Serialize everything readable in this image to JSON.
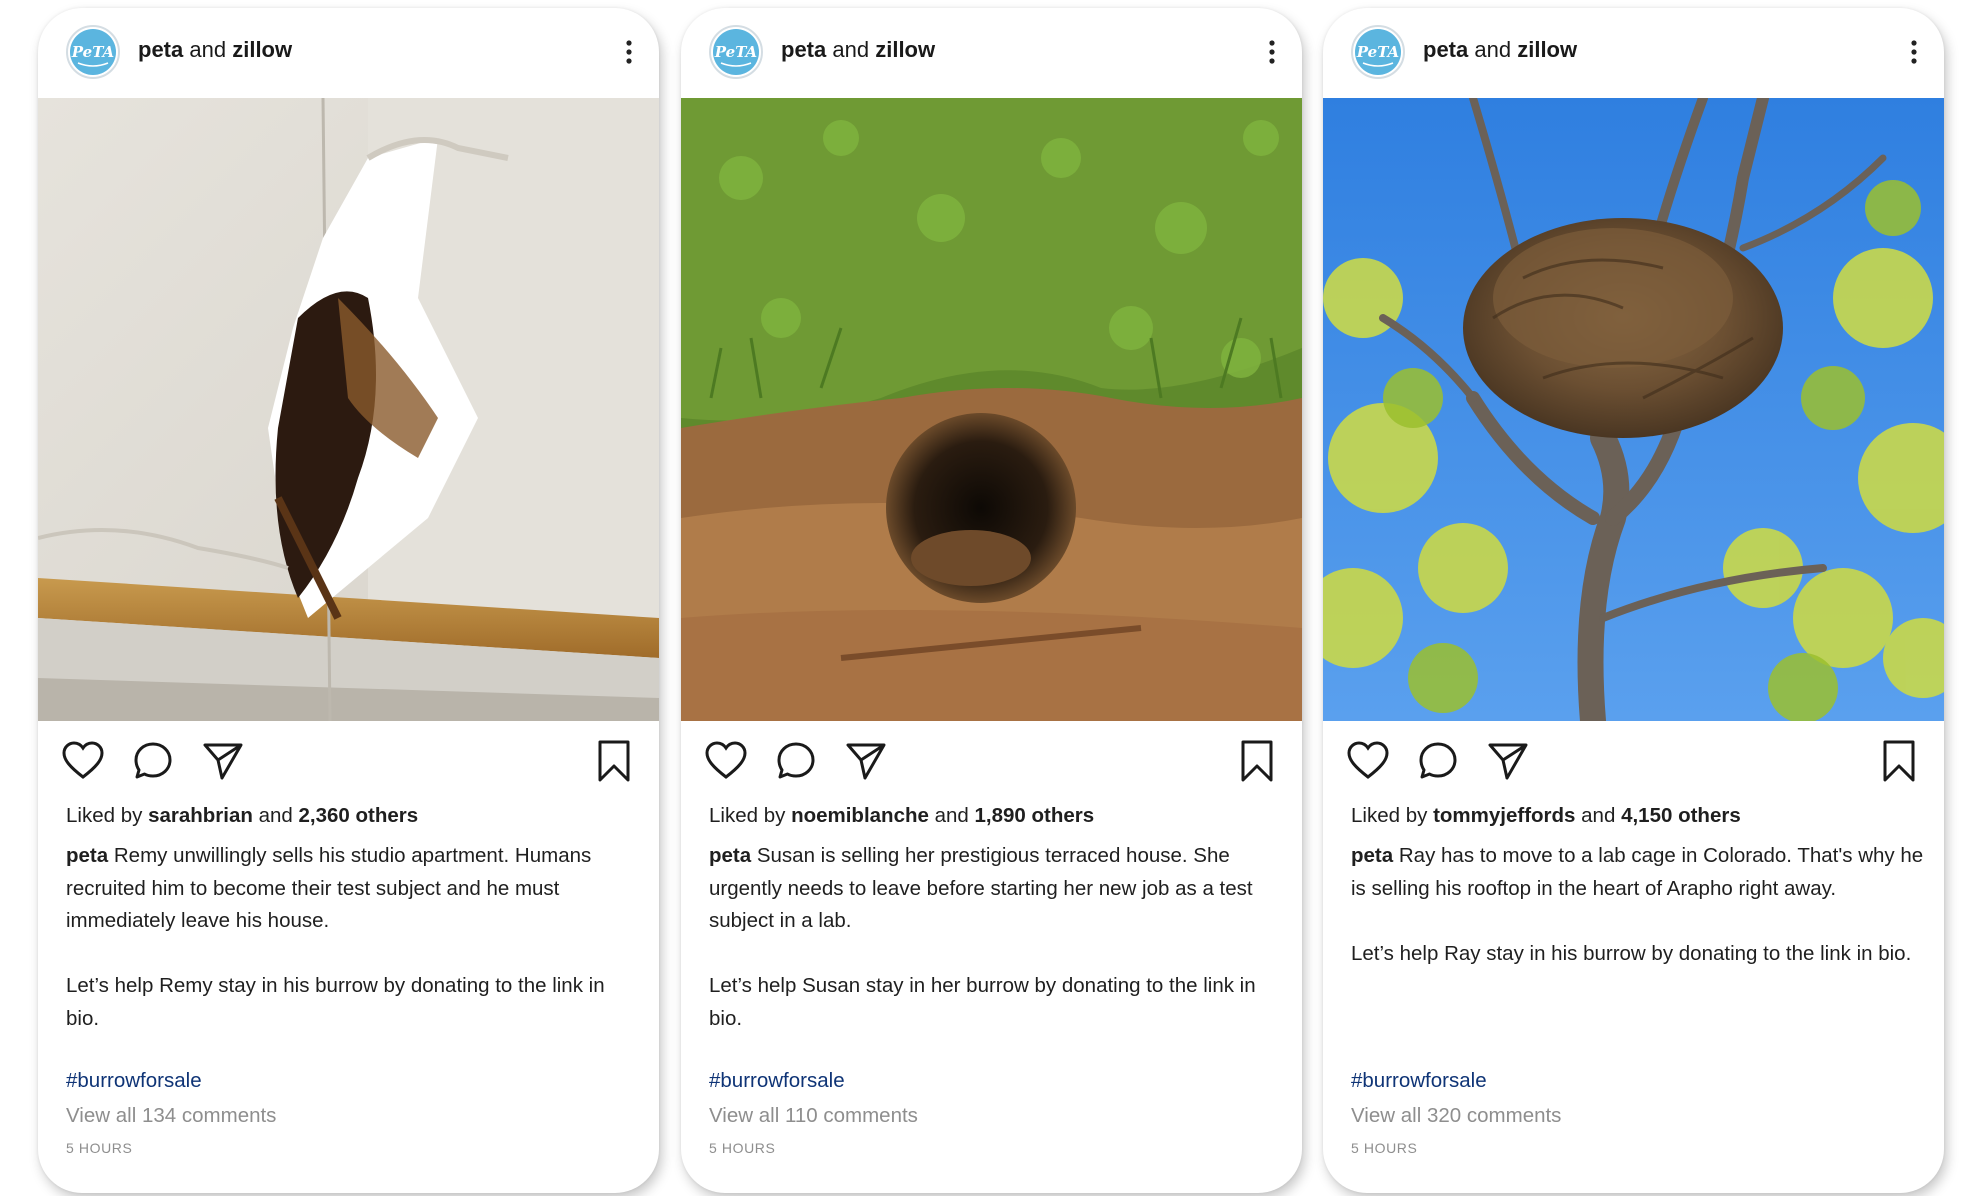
{
  "colors": {
    "accent_link": "#0f3476",
    "muted_text": "#8e8e8e",
    "peta_logo_blue": "#5bb5df"
  },
  "icons": {
    "avatar": "peta-logo-icon",
    "more": "more-vertical-icon",
    "like": "heart-icon",
    "comment": "comment-bubble-icon",
    "share": "paper-plane-icon",
    "save": "bookmark-icon"
  },
  "posts": [
    {
      "avatar_text": "PeTA",
      "account": {
        "primary": "peta",
        "joiner": "and",
        "secondary": "zillow"
      },
      "image": {
        "subject": "damaged drywall corner with gnawed mouse hole"
      },
      "likes": {
        "prefix": "Liked by",
        "user": "sarahbrian",
        "joiner": "and",
        "others": "2,360 others"
      },
      "caption": {
        "author": "peta",
        "text1": "Remy unwillingly sells his studio apartment. Humans recruited him to become their test subject and he must immediately leave his house.",
        "text2": "Let’s help Remy stay in his burrow by donating to the link in bio."
      },
      "hashtag": "#burrowforsale",
      "comments": {
        "prefix": "View all",
        "count_text": "134 comments"
      },
      "timestamp": "5 HOURS"
    },
    {
      "avatar_text": "PeTA",
      "account": {
        "primary": "peta",
        "joiner": "and",
        "secondary": "zillow"
      },
      "image": {
        "subject": "burrow hole in grassy dirt bank"
      },
      "likes": {
        "prefix": "Liked by",
        "user": "noemiblanche",
        "joiner": "and",
        "others": "1,890 others"
      },
      "caption": {
        "author": "peta",
        "text1": "Susan is selling her prestigious terraced house. She urgently needs to leave before starting her new job as a test subject in a lab.",
        "text2": "Let’s help Susan stay in her burrow by donating to the link in bio."
      },
      "hashtag": "#burrowforsale",
      "comments": {
        "prefix": "View all",
        "count_text": "110 comments"
      },
      "timestamp": "5 HOURS"
    },
    {
      "avatar_text": "PeTA",
      "account": {
        "primary": "peta",
        "joiner": "and",
        "secondary": "zillow"
      },
      "image": {
        "subject": "leafy nest in tree branches against blue sky"
      },
      "likes": {
        "prefix": "Liked by",
        "user": "tommyjeffords",
        "joiner": "and",
        "others": "4,150 others"
      },
      "caption": {
        "author": "peta",
        "text1": "Ray has to move to a lab cage in Colorado. That's why he is selling his rooftop in the heart of Arapho right away.",
        "text2": "Let’s help Ray stay in his burrow by donating to the link in bio."
      },
      "hashtag": "#burrowforsale",
      "comments": {
        "prefix": "View all",
        "count_text": "320 comments"
      },
      "timestamp": "5 HOURS"
    }
  ]
}
